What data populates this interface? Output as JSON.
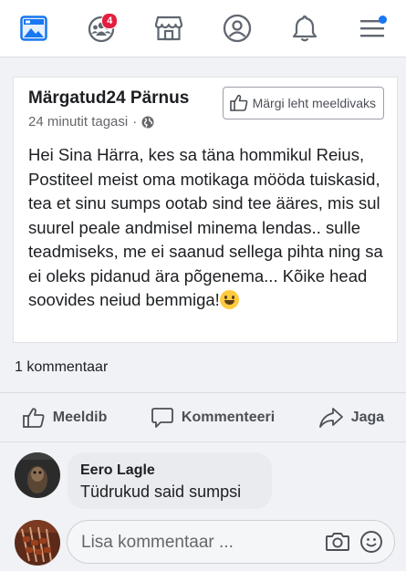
{
  "nav": {
    "items": [
      {
        "id": "news-feed",
        "icon": "news-feed-icon",
        "active": true
      },
      {
        "id": "groups",
        "icon": "friends-icon",
        "badge": "4"
      },
      {
        "id": "marketplace",
        "icon": "marketplace-icon"
      },
      {
        "id": "profile",
        "icon": "profile-icon"
      },
      {
        "id": "notifications",
        "icon": "bell-icon"
      },
      {
        "id": "menu",
        "icon": "menu-icon",
        "dot": true
      }
    ],
    "accent_color": "#1877f2",
    "badge_color": "#e41e3f"
  },
  "post": {
    "page_name": "Märgatud24 Pärnus",
    "timestamp": "24 minutit tagasi",
    "privacy_icon": "globe-icon",
    "like_page_label": "Märgi leht meeldivaks",
    "text": "Hei Sina Härra, kes sa täna hommikul Reius, Postiteel meist oma motikaga mööda tuiskasid, tea et sinu sumps ootab sind tee ääres, mis sul suurel peale andmisel minema lendas.. sulle teadmiseks, me ei saanud sellega pihta ning sa ei oleks pidanud ära põgenema... Kõike head soovides neiud bemmiga!",
    "emoji": "grinning-face-icon",
    "comment_count": "1 kommentaar"
  },
  "actions": {
    "like": "Meeldib",
    "comment": "Kommenteeri",
    "share": "Jaga"
  },
  "comment": {
    "author": "Eero Lagle",
    "text": "Tüdrukud said sumpsi"
  },
  "reply": {
    "placeholder": "Lisa kommentaar ..."
  }
}
